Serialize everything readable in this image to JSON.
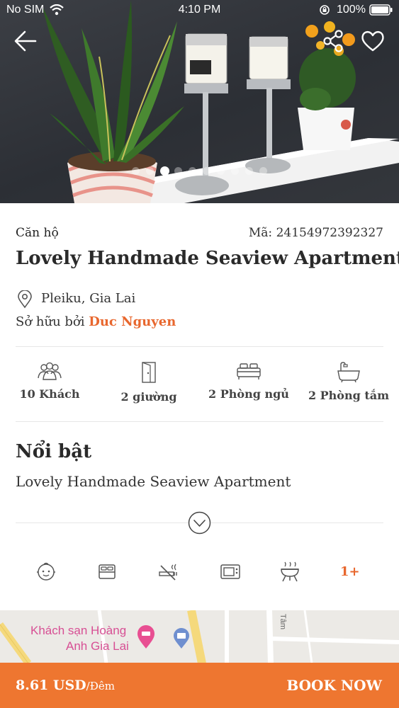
{
  "status_bar": {
    "carrier": "No SIM",
    "time": "4:10 PM",
    "battery": "100%"
  },
  "gallery": {
    "photo_count": 10,
    "active_index": 2
  },
  "listing": {
    "type": "Căn hộ",
    "code": "Mã: 24154972392327",
    "title": "Lovely Handmade Seaview Apartment",
    "location": "Pleiku, Gia Lai",
    "owner_prefix": "Sở hữu bởi ",
    "owner_name": "Duc Nguyen"
  },
  "facilities": [
    {
      "icon": "guests-icon",
      "label": "10 Khách"
    },
    {
      "icon": "door-icon",
      "label": "2 giường"
    },
    {
      "icon": "bed-icon",
      "label": "2 Phòng ngủ"
    },
    {
      "icon": "bathtub-icon",
      "label": "2 Phòng tắm"
    }
  ],
  "highlights": {
    "title": "Nổi bật",
    "description": "Lovely Handmade Seaview Apartment"
  },
  "amenities": {
    "icons": [
      "baby-icon",
      "bed-icon",
      "no-smoking-icon",
      "microwave-icon",
      "bbq-grill-icon"
    ],
    "more_label": "1+"
  },
  "map": {
    "poi_line1": "Khách sạn Hoàng",
    "poi_line2": "Anh Gia Lai",
    "street": "Tâm"
  },
  "booking": {
    "price": "8.61 USD",
    "per_unit": "/Đêm",
    "cta": "BOOK NOW"
  },
  "colors": {
    "accent": "#ee7630",
    "owner": "#e8672e",
    "map_poi": "#d74f94"
  }
}
